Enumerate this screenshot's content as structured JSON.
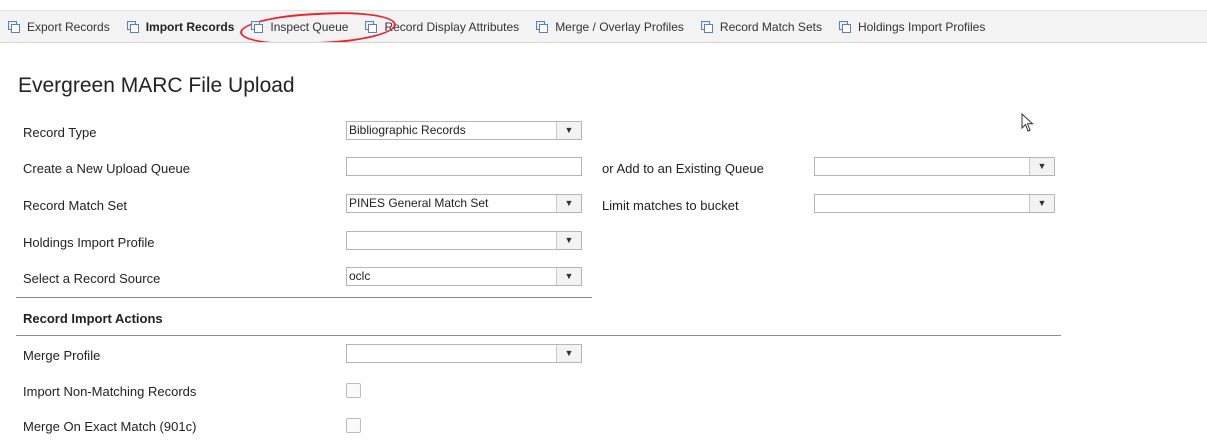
{
  "tabs": [
    {
      "label": "Export Records",
      "icon": "copy-icon",
      "bold": false
    },
    {
      "label": "Import Records",
      "icon": "copy-icon",
      "bold": true
    },
    {
      "label": "Inspect Queue",
      "icon": "copy-icon",
      "bold": false,
      "highlighted": true
    },
    {
      "label": "Record Display Attributes",
      "icon": "copy-icon",
      "bold": false
    },
    {
      "label": "Merge / Overlay Profiles",
      "icon": "copy-icon",
      "bold": false
    },
    {
      "label": "Record Match Sets",
      "icon": "copy-icon",
      "bold": false
    },
    {
      "label": "Holdings Import Profiles",
      "icon": "copy-icon",
      "bold": false
    }
  ],
  "page_title": "Evergreen MARC File Upload",
  "form": {
    "record_type": {
      "label": "Record Type",
      "value": "Bibliographic Records"
    },
    "new_queue": {
      "label": "Create a New Upload Queue",
      "value": ""
    },
    "existing_queue": {
      "label": "or Add to an Existing Queue",
      "value": ""
    },
    "match_set": {
      "label": "Record Match Set",
      "value": "PINES General Match Set"
    },
    "limit_bucket": {
      "label": "Limit matches to bucket",
      "value": ""
    },
    "holdings_profile": {
      "label": "Holdings Import Profile",
      "value": ""
    },
    "record_source": {
      "label": "Select a Record Source",
      "value": "oclc"
    },
    "section_import_actions": "Record Import Actions",
    "merge_profile": {
      "label": "Merge Profile",
      "value": ""
    },
    "import_non_matching": {
      "label": "Import Non-Matching Records",
      "checked": false
    },
    "merge_exact": {
      "label": "Merge On Exact Match (901c)",
      "checked": false
    }
  },
  "colors": {
    "highlight_circle": "#e8252b",
    "tabbar_bg": "#f3f3f3"
  }
}
